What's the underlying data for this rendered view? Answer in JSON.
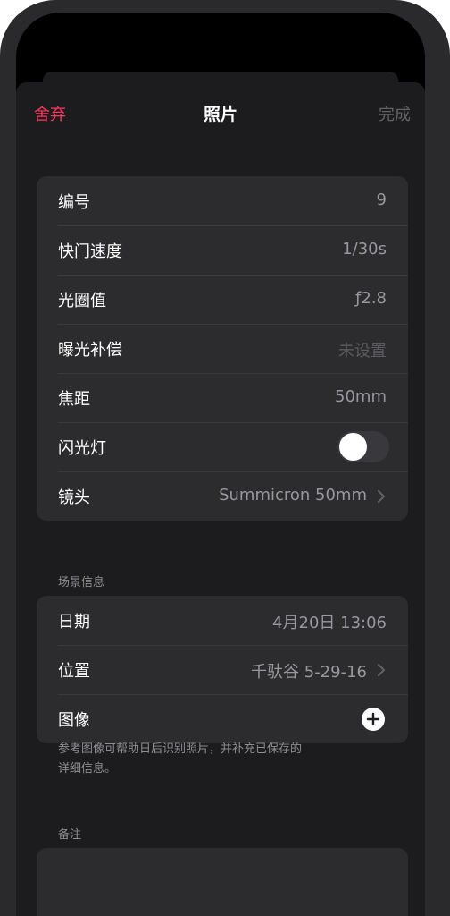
{
  "nav": {
    "discard_label": "舍弃",
    "title": "照片",
    "done_label": "完成"
  },
  "details": [
    {
      "label": "编号",
      "value": "9"
    },
    {
      "label": "快门速度",
      "value": "1/30s"
    },
    {
      "label": "光圈值",
      "value": "ƒ2.8"
    },
    {
      "label": "曝光补偿",
      "value": "未设置"
    },
    {
      "label": "焦距",
      "value": "50mm"
    },
    {
      "label": "闪光灯",
      "toggle_on": false
    },
    {
      "label": "镜头",
      "value": "Summicron 50mm"
    }
  ],
  "scene": {
    "header": "场景信息",
    "date_label": "日期",
    "date_value": "4月20日 13:06",
    "location_label": "位置",
    "location_value": "千驮谷 5-29-16",
    "image_label": "图像",
    "footer_line1": "参考图像可帮助日后识别照片，并补充已保存的",
    "footer_line2": "详细信息。"
  },
  "notes": {
    "header": "备注",
    "value": ""
  },
  "colors": {
    "accent_destructive": "#ff375f",
    "done_disabled": "#636366",
    "cell_background": "#2c2c2e",
    "sheet_background": "#1c1c1e"
  },
  "icons": [
    "chevron-right-icon",
    "plus-circle-icon"
  ]
}
